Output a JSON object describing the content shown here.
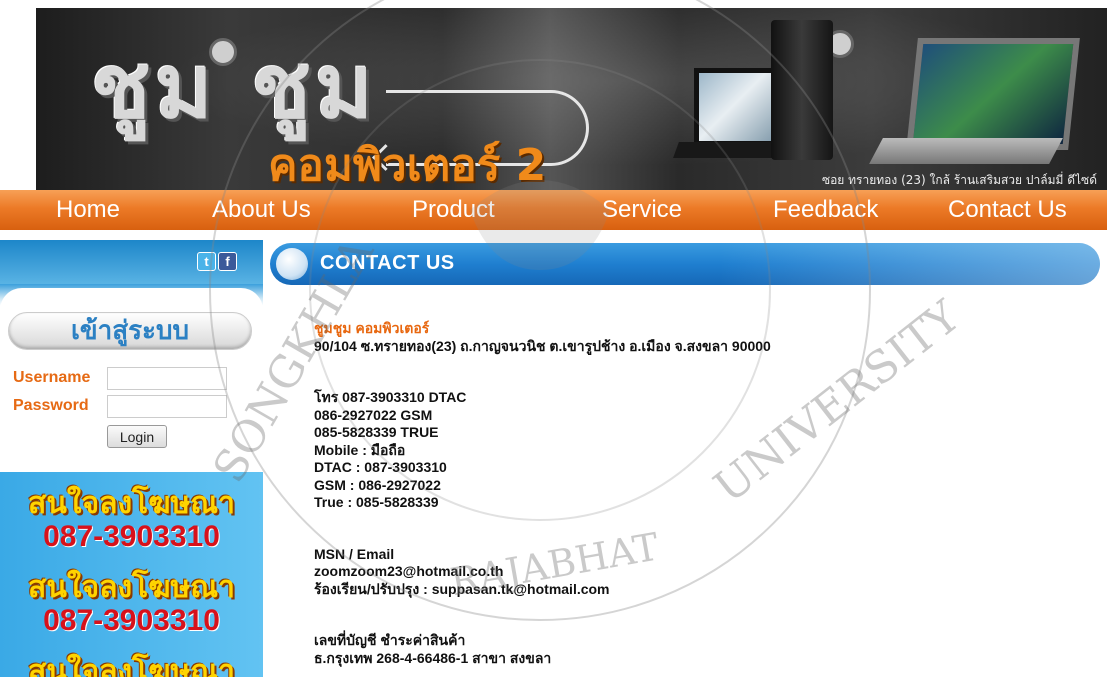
{
  "banner": {
    "logo_big": "ชูม ชูม",
    "logo_sub": "คอมพิวเตอร์ 2",
    "address": "ซอย ทรายทอง (23) ใกล้ ร้านเสริมสวย ปาล์มมี่ ดีไซด์"
  },
  "nav": {
    "items": [
      {
        "label": "Home"
      },
      {
        "label": "About Us"
      },
      {
        "label": "Product"
      },
      {
        "label": "Service"
      },
      {
        "label": "Feedback"
      },
      {
        "label": "Contact Us"
      }
    ]
  },
  "sidebar": {
    "social": {
      "twitter": "t",
      "facebook": "f"
    },
    "login": {
      "title": "เข้าสู่ระบบ",
      "username_label": "Username",
      "password_label": "Password",
      "username_value": "",
      "password_value": "",
      "button_label": "Login"
    },
    "ads": [
      {
        "line1": "สนใจลงโฆษณา",
        "line2": "087-3903310"
      },
      {
        "line1": "สนใจลงโฆษณา",
        "line2": "087-3903310"
      },
      {
        "line1": "สนใจลงโฆษณา"
      }
    ]
  },
  "content": {
    "section_title": "CONTACT US",
    "shop_name": "ชูมชูม คอมพิวเตอร์",
    "address": "90/104  ซ.ทรายทอง(23) ถ.กาญจนวนิช  ต.เขารูปช้าง  อ.เมือง จ.สงขลา 90000",
    "phones": [
      "โทร 087-3903310   DTAC",
      "086-2927022     GSM",
      "085-5828339     TRUE",
      "Mobile : มือถือ",
      "DTAC : 087-3903310",
      "GSM  : 086-2927022",
      "True  :   085-5828339"
    ],
    "msn_label": "MSN / Email",
    "email": "zoomzoom23@hotmail.co.th",
    "complaint": "ร้องเรียน/ปรับปรุง : suppasan.tk@hotmail.com",
    "bank_title": "เลขที่บัญชี ชำระค่าสินค้า",
    "bank_line": "ธ.กรุงเทพ       268-4-66486-1 สาขา สงขลา"
  },
  "watermark": {
    "text_left": "SONGKHLA",
    "text_right": "UNIVERSITY",
    "text_bottom": "RAJABHAT"
  }
}
